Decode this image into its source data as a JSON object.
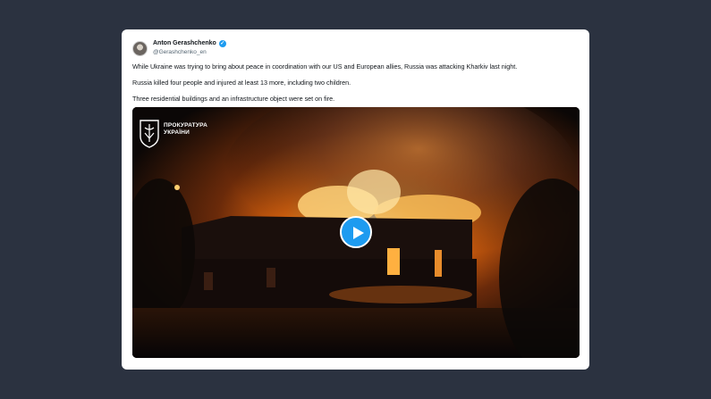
{
  "tweet": {
    "author_name": "Anton Gerashchenko",
    "author_handle": "@Gerashchenko_en",
    "verified_icon": "verified-badge-icon",
    "paragraphs": [
      "While Ukraine was trying to bring about peace in coordination with our US and European allies, Russia was attacking Kharkiv last night.",
      "Russia killed four people and injured at least 13 more, including two children.",
      "Three residential buildings and an infrastructure object were set on fire."
    ]
  },
  "media": {
    "watermark_line1": "ПРОКУРАТУРА",
    "watermark_line2": "УКРАЇНИ",
    "play_icon": "play-icon"
  },
  "colors": {
    "background": "#2b3240",
    "card": "#ffffff",
    "accent": "#1d9bf0"
  }
}
